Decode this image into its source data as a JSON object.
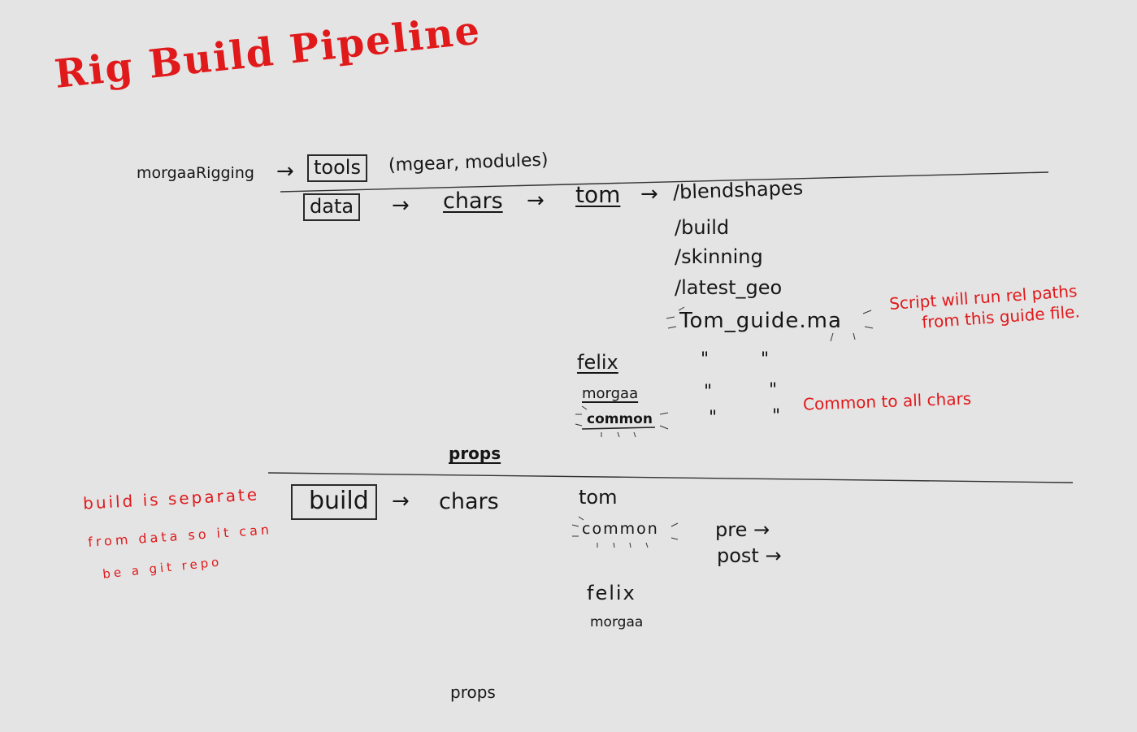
{
  "title": "Rig Build Pipeline",
  "data_section": {
    "root": "morgaaRigging",
    "arrow": "→",
    "tools_box": "tools",
    "tools_note": "(mgear, modules)",
    "data_box": "data",
    "chars": "chars",
    "tom": "tom",
    "folders": [
      "/blendshapes",
      "/build",
      "/skinning",
      "/latest_geo",
      "Tom_guide.ma"
    ],
    "guide_note_line1": "Script will run rel paths",
    "guide_note_line2": "from this guide file.",
    "other_chars": [
      "felix",
      "morgaa",
      "common"
    ],
    "ditto": "\"",
    "common_note": "Common to all chars",
    "props": "props"
  },
  "build_section": {
    "build_box": "build",
    "chars": "chars",
    "tom": "tom",
    "common": "common",
    "pre": "pre →",
    "post": "post →",
    "felix": "felix",
    "morgaa": "morgaa",
    "props": "props",
    "note_line1": "build is separate",
    "note_line2": "from data so it can",
    "note_line3": "be a git repo"
  }
}
